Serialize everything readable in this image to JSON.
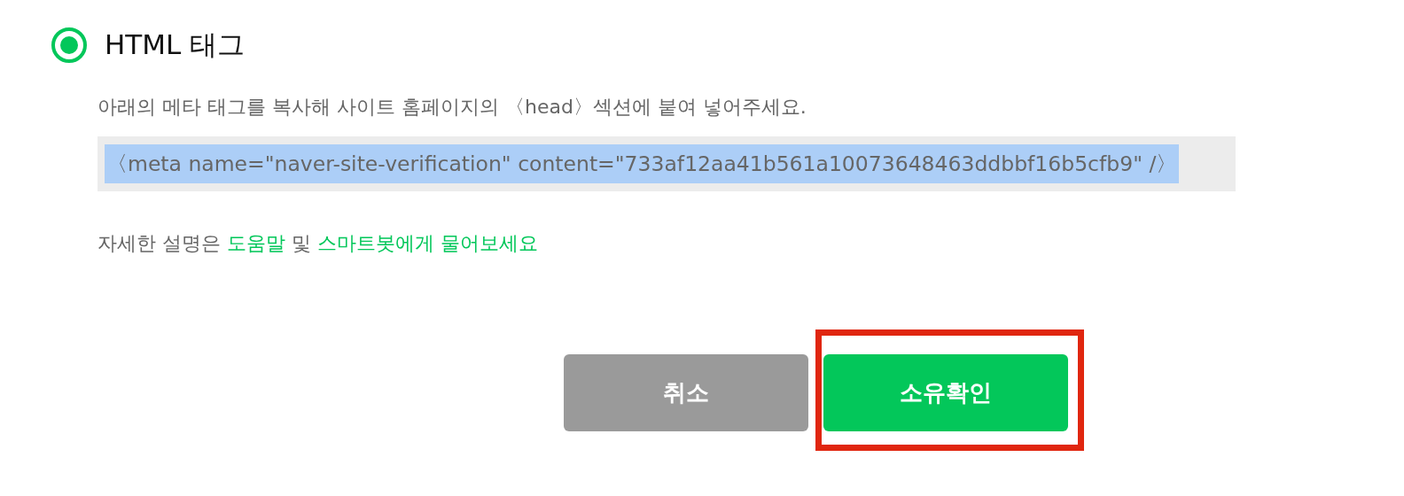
{
  "option": {
    "label": "HTML 태그",
    "selected": true
  },
  "instruction": "아래의 메타 태그를 복사해 사이트 홈페이지의 〈head〉섹션에 붙여 넣어주세요.",
  "code_field": {
    "value": "〈meta name=\"naver-site-verification\" content=\"733af12aa41b561a10073648463ddbbf16b5cfb9\" /〉",
    "selected": true
  },
  "help": [
    {
      "kind": "text",
      "text": "자세한 설명은"
    },
    {
      "kind": "link",
      "text": "도움말"
    },
    {
      "kind": "text",
      "text": "및"
    },
    {
      "kind": "link",
      "text": "스마트봇에게 물어보세요"
    }
  ],
  "buttons": [
    {
      "kind": "secondary",
      "label": "취소"
    },
    {
      "kind": "primary",
      "label": "소유확인",
      "highlighted": true
    }
  ]
}
